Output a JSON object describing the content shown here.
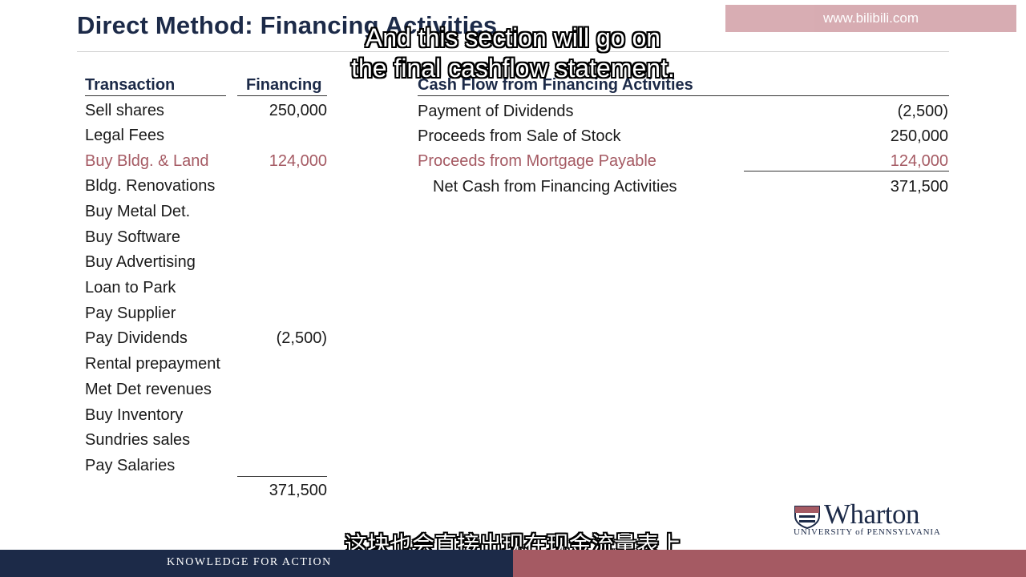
{
  "slide": {
    "title": "Direct Method: Financing Activities",
    "watermark": "www.bilibili.com"
  },
  "left_table": {
    "col_transaction": "Transaction",
    "col_financing": "Financing",
    "rows": [
      {
        "name": "Sell shares",
        "value": "250,000",
        "highlight": false
      },
      {
        "name": "Legal Fees",
        "value": "",
        "highlight": false
      },
      {
        "name": "Buy Bldg. & Land",
        "value": "124,000",
        "highlight": true
      },
      {
        "name": "Bldg. Renovations",
        "value": "",
        "highlight": false
      },
      {
        "name": "Buy Metal Det.",
        "value": "",
        "highlight": false
      },
      {
        "name": "Buy Software",
        "value": "",
        "highlight": false
      },
      {
        "name": "Buy Advertising",
        "value": "",
        "highlight": false
      },
      {
        "name": "Loan to Park",
        "value": "",
        "highlight": false
      },
      {
        "name": "Pay Supplier",
        "value": "",
        "highlight": false
      },
      {
        "name": "Pay Dividends",
        "value": "(2,500)",
        "highlight": false
      },
      {
        "name": "Rental prepayment",
        "value": "",
        "highlight": false
      },
      {
        "name": "Met Det revenues",
        "value": "",
        "highlight": false
      },
      {
        "name": "Buy Inventory",
        "value": "",
        "highlight": false
      },
      {
        "name": "Sundries sales",
        "value": "",
        "highlight": false
      },
      {
        "name": "Pay Salaries",
        "value": "",
        "highlight": false
      }
    ],
    "total": "371,500"
  },
  "right_table": {
    "header": "Cash Flow from Financing Activities",
    "rows": [
      {
        "name": "Payment of Dividends",
        "value": "(2,500)",
        "highlight": false
      },
      {
        "name": "Proceeds from Sale of Stock",
        "value": "250,000",
        "highlight": false
      },
      {
        "name": "Proceeds from Mortgage Payable",
        "value": "124,000",
        "highlight": true
      }
    ],
    "net_label": "Net Cash from Financing Activities",
    "net_value": "371,500"
  },
  "subtitles": {
    "english_line1": "And this section will go on",
    "english_line2": "the final cashflow statement.",
    "chinese": "这块也会直接出现在现金流量表上"
  },
  "logo": {
    "wordmark": "Wharton",
    "subtitle": "UNIVERSITY of PENNSYLVANIA"
  },
  "footer": {
    "tagline": "KNOWLEDGE FOR ACTION"
  },
  "colors": {
    "navy": "#1c2a48",
    "highlight_red": "#a55a63"
  }
}
